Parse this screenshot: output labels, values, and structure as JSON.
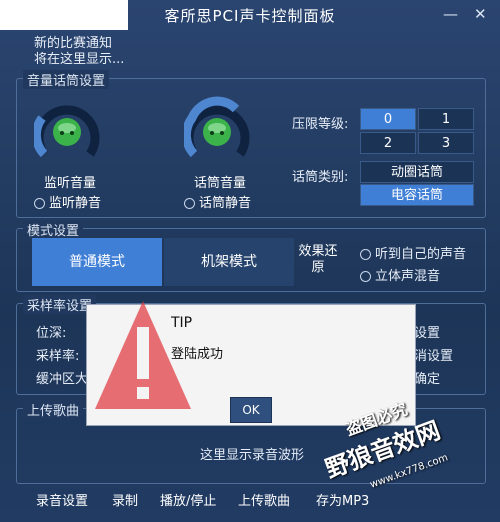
{
  "window": {
    "title": "客所思PCI声卡控制面板",
    "minimize_glyph": "—",
    "close_glyph": "✕"
  },
  "notice": {
    "line1": "新的比赛通知",
    "line2": "将在这里显示..."
  },
  "volume_group": {
    "title": "音量话筒设置",
    "monitor": {
      "label": "监听音量",
      "mute_label": "监听静音"
    },
    "mic": {
      "label": "话筒音量",
      "mute_label": "话筒静音"
    },
    "limit_label": "压限等级:",
    "limit_levels": [
      "0",
      "1",
      "2",
      "3"
    ],
    "limit_selected": "0",
    "mic_type_label": "话筒类别:",
    "mic_types": [
      "动圈话筒",
      "电容话筒"
    ],
    "mic_type_selected": "电容话筒"
  },
  "mode_group": {
    "title": "模式设置",
    "normal": "普通模式",
    "rack": "机架模式",
    "restore": "效果还原",
    "hear_self": "听到自己的声音",
    "stereo_mix": "立体声混音"
  },
  "sample_group": {
    "title": "采样率设置",
    "bit_depth_label": "位深:",
    "sample_rate_label": "采样率:",
    "buffer_label": "缓冲区大",
    "btn_set": "设置",
    "btn_cancel": "消设置",
    "btn_ok": "确定"
  },
  "upload_group": {
    "title": "上传歌曲",
    "waveform_placeholder": "这里显示录音波形"
  },
  "footer": {
    "record_settings": "录音设置",
    "record": "录制",
    "play_stop": "播放/停止",
    "upload": "上传歌曲",
    "save_as": "存为MP3"
  },
  "dialog": {
    "title": "TIP",
    "message": "登陆成功",
    "ok": "OK"
  },
  "watermark": {
    "line1": "盗图必究",
    "line2": "野狼音效网",
    "url": "www.kx778.com"
  },
  "colors": {
    "background": "#1d3557",
    "accent": "#3f7fd6",
    "warning_red": "#e0343a"
  }
}
